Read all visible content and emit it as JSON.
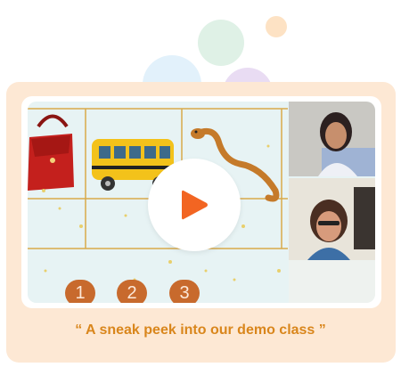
{
  "caption": "“ A sneak peek into our demo class ”",
  "video": {
    "lesson_numbers": [
      "1",
      "2",
      "3"
    ],
    "play_icon": "play-icon",
    "pictures": [
      "handbag",
      "school-bus",
      "snake"
    ],
    "participants": [
      "teacher-webcam",
      "student-webcam"
    ]
  },
  "colors": {
    "card_bg": "#fde8d4",
    "accent": "#f26522",
    "caption": "#d9861c",
    "grid_line": "#d8a94a",
    "number_badge": "#c86a2d"
  }
}
